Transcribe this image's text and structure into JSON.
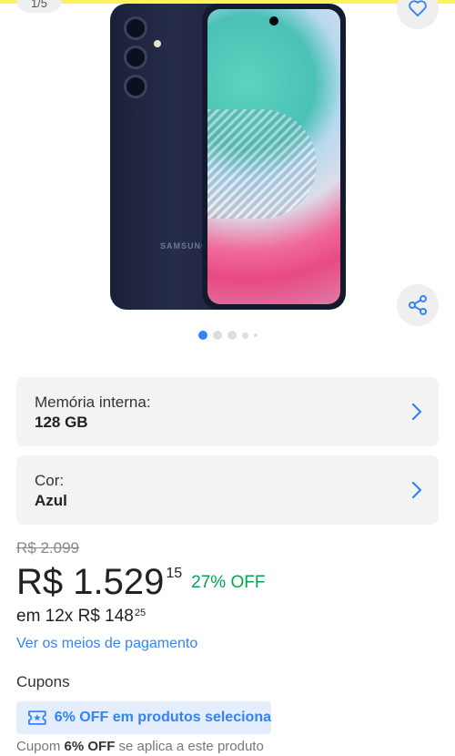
{
  "gallery": {
    "counter": "1/5",
    "brand": "SAMSUNG",
    "dots": 5,
    "active_dot": 0
  },
  "variants": [
    {
      "label": "Memória interna:",
      "value": "128 GB"
    },
    {
      "label": "Cor:",
      "value": "Azul"
    }
  ],
  "price": {
    "original": "R$ 2.099",
    "current_main": "R$ 1.529",
    "current_cents": "15",
    "discount": "27% OFF",
    "installments_prefix": "em 12x R$ 148",
    "installments_cents": "25",
    "payment_link": "Ver os meios de pagamento"
  },
  "coupons": {
    "title": "Cupons",
    "chip_text": "6% OFF em produtos seleciona",
    "note_prefix": "Cupom",
    "note_bold": "6% OFF",
    "note_suffix": "se aplica a este produto"
  },
  "colors": {
    "accent": "#3483fa",
    "success": "#00a650",
    "brand_yellow": "#fff159"
  },
  "icons": [
    "heart-icon",
    "share-icon",
    "chevron-right-icon",
    "coupon-icon"
  ]
}
